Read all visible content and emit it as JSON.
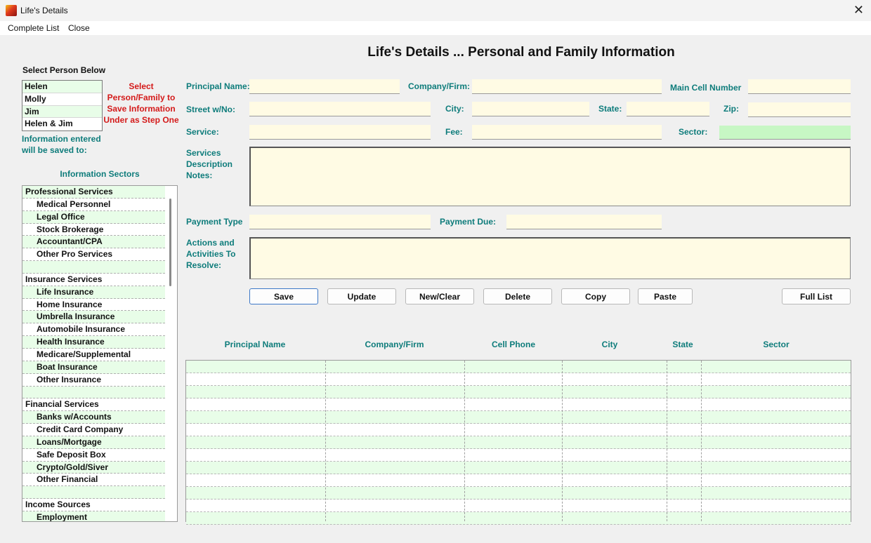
{
  "window": {
    "title": "Life's Details",
    "close_glyph": "✕"
  },
  "menu": {
    "items": [
      "Complete List",
      "Close"
    ]
  },
  "main_title": "Life's Details ... Personal and Family Information",
  "left": {
    "select_heading": "Select Person Below",
    "persons": [
      "Helen",
      "Molly",
      "Jim",
      "Helen & Jim"
    ],
    "instruction_lines": [
      "Select",
      "Person/Family to",
      "Save Information",
      "Under as Step One"
    ],
    "saved_to_lines": [
      "Information entered",
      "will be saved to:"
    ],
    "sectors_heading": "Information Sectors",
    "sectors": [
      {
        "label": "Professional Services",
        "sub": false
      },
      {
        "label": "Medical Personnel",
        "sub": true
      },
      {
        "label": "Legal Office",
        "sub": true
      },
      {
        "label": "Stock Brokerage",
        "sub": true
      },
      {
        "label": "Accountant/CPA",
        "sub": true
      },
      {
        "label": "Other Pro Services",
        "sub": true
      },
      {
        "label": "",
        "sub": false
      },
      {
        "label": "Insurance Services",
        "sub": false
      },
      {
        "label": "Life Insurance",
        "sub": true
      },
      {
        "label": "Home Insurance",
        "sub": true
      },
      {
        "label": "Umbrella Insurance",
        "sub": true
      },
      {
        "label": "Automobile Insurance",
        "sub": true
      },
      {
        "label": "Health Insurance",
        "sub": true
      },
      {
        "label": "Medicare/Supplemental",
        "sub": true
      },
      {
        "label": "Boat Insurance",
        "sub": true
      },
      {
        "label": "Other Insurance",
        "sub": true
      },
      {
        "label": "",
        "sub": false
      },
      {
        "label": "Financial Services",
        "sub": false
      },
      {
        "label": "Banks w/Accounts",
        "sub": true
      },
      {
        "label": "Credit Card Company",
        "sub": true
      },
      {
        "label": "Loans/Mortgage",
        "sub": true
      },
      {
        "label": "Safe Deposit Box",
        "sub": true
      },
      {
        "label": "Crypto/Gold/Siver",
        "sub": true
      },
      {
        "label": "Other Financial",
        "sub": true
      },
      {
        "label": "",
        "sub": false
      },
      {
        "label": "Income Sources",
        "sub": false
      },
      {
        "label": "Employment",
        "sub": true
      }
    ]
  },
  "form": {
    "principal_name_label": "Principal Name:",
    "company_label": "Company/Firm:",
    "main_cell_label": "Main Cell Number",
    "street_label": "Street w/No:",
    "city_label": "City:",
    "state_label": "State:",
    "zip_label": "Zip:",
    "service_label": "Service:",
    "fee_label": "Fee:",
    "sector_label": "Sector:",
    "services_desc_lines": [
      "Services",
      "Description",
      "Notes:"
    ],
    "payment_type_label": "Payment Type",
    "payment_due_label": "Payment Due:",
    "actions_lines": [
      "Actions and",
      "Activities To",
      "Resolve:"
    ],
    "values": {
      "principal_name": "",
      "company": "",
      "main_cell": "",
      "street": "",
      "city": "",
      "state": "",
      "zip": "",
      "service": "",
      "fee": "",
      "sector": "",
      "services_desc": "",
      "payment_type": "",
      "payment_due": "",
      "actions": ""
    }
  },
  "buttons": {
    "save": "Save",
    "update": "Update",
    "new_clear": "New/Clear",
    "delete": "Delete",
    "copy": "Copy",
    "paste": "Paste",
    "full_list": "Full List"
  },
  "table": {
    "columns": [
      "Principal Name",
      "Company/Firm",
      "Cell Phone",
      "City",
      "State",
      "Sector"
    ],
    "rows": []
  },
  "colors": {
    "label_teal": "#0e7c7b",
    "instruction_red": "#d41a1a",
    "field_yellow": "#fffbe4",
    "row_green": "#e8fde8",
    "sector_field_green": "#c7f7c4"
  }
}
